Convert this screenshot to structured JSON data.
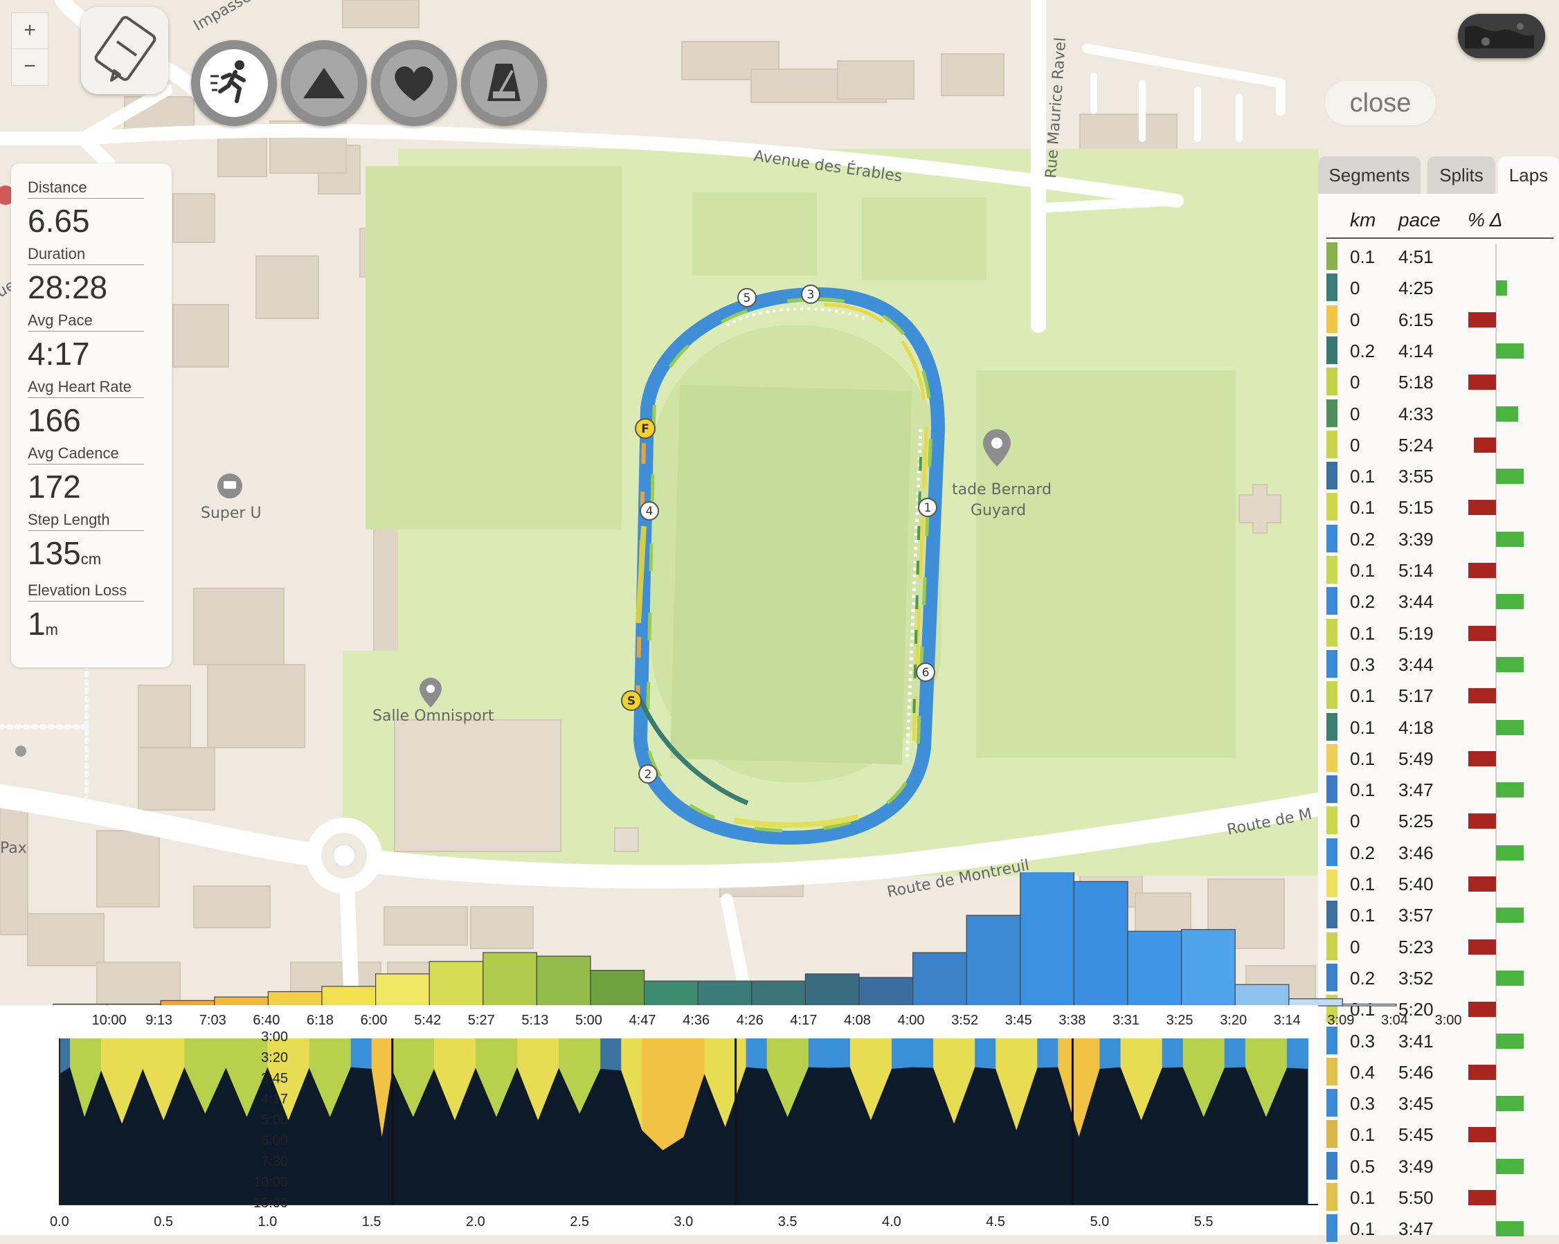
{
  "map": {
    "labels": {
      "impasse": "Impasse",
      "avenue": "Avenue des Érables",
      "rue_ravel": "Rue Maurice Ravel",
      "super_u": "Super U",
      "salle": "Salle Omnisport",
      "stade_line1": "tade Bernard",
      "stade_line2": "Guyard",
      "route1": "Route de M",
      "route2": "Route de Montreuil",
      "pax": "Pax",
      "ue": "ue"
    },
    "markers": {
      "start": "S",
      "finish": "F",
      "laps": [
        "1",
        "2",
        "3",
        "4",
        "5",
        "6"
      ]
    },
    "zoom_in": "+",
    "zoom_out": "−",
    "colors": {
      "grass": "#cfe3a4",
      "park": "#dcebb6",
      "building": "#dfd5c6",
      "road": "#ffffff",
      "track_blue": "#3f8fd8"
    }
  },
  "controls": {
    "modes": [
      {
        "icon": "runner-icon",
        "active": true
      },
      {
        "icon": "mountain-icon",
        "active": false
      },
      {
        "icon": "heart-icon",
        "active": false
      },
      {
        "icon": "metronome-icon",
        "active": false
      }
    ],
    "close_label": "close"
  },
  "stats": [
    {
      "label": "Distance",
      "value": "6.65",
      "unit": ""
    },
    {
      "label": "Duration",
      "value": "28:28",
      "unit": ""
    },
    {
      "label": "Avg Pace",
      "value": "4:17",
      "unit": ""
    },
    {
      "label": "Avg Heart Rate",
      "value": "166",
      "unit": ""
    },
    {
      "label": "Avg Cadence",
      "value": "172",
      "unit": ""
    },
    {
      "label": "Step Length",
      "value": "135",
      "unit": "cm"
    },
    {
      "label": "Elevation Loss",
      "value": "1",
      "unit": "m"
    }
  ],
  "tabs": [
    {
      "label": "Segments",
      "active": false
    },
    {
      "label": "Splits",
      "active": false
    },
    {
      "label": "Laps",
      "active": true
    }
  ],
  "laps": {
    "headers": {
      "km": "km",
      "pace": "pace",
      "delta": "% Δ"
    },
    "rows": [
      {
        "km": "0.1",
        "pace": "4:51",
        "color": "#8bb24a",
        "delta": 0
      },
      {
        "km": "0",
        "pace": "4:25",
        "color": "#3a7f78",
        "delta": 0.4
      },
      {
        "km": "0",
        "pace": "6:15",
        "color": "#f1c644",
        "delta": -1
      },
      {
        "km": "0.2",
        "pace": "4:14",
        "color": "#39786f",
        "delta": 1
      },
      {
        "km": "0",
        "pace": "5:18",
        "color": "#c4d24a",
        "delta": -1
      },
      {
        "km": "0",
        "pace": "4:33",
        "color": "#4e8f5a",
        "delta": 0.8
      },
      {
        "km": "0",
        "pace": "5:24",
        "color": "#c9d34b",
        "delta": -0.8
      },
      {
        "km": "0.1",
        "pace": "3:55",
        "color": "#3c6fa2",
        "delta": 1
      },
      {
        "km": "0.1",
        "pace": "5:15",
        "color": "#ccd84a",
        "delta": -1
      },
      {
        "km": "0.2",
        "pace": "3:39",
        "color": "#3b8bd6",
        "delta": 1
      },
      {
        "km": "0.1",
        "pace": "5:14",
        "color": "#c9d84d",
        "delta": -1
      },
      {
        "km": "0.2",
        "pace": "3:44",
        "color": "#3b8bd6",
        "delta": 1
      },
      {
        "km": "0.1",
        "pace": "5:19",
        "color": "#c7d64a",
        "delta": -1
      },
      {
        "km": "0.3",
        "pace": "3:44",
        "color": "#3b8bd6",
        "delta": 1
      },
      {
        "km": "0.1",
        "pace": "5:17",
        "color": "#c8d64b",
        "delta": -1
      },
      {
        "km": "0.1",
        "pace": "4:18",
        "color": "#3c7f70",
        "delta": 1
      },
      {
        "km": "0.1",
        "pace": "5:49",
        "color": "#eecf50",
        "delta": -1
      },
      {
        "km": "0.1",
        "pace": "3:47",
        "color": "#3d7cc0",
        "delta": 1
      },
      {
        "km": "0",
        "pace": "5:25",
        "color": "#cbd74a",
        "delta": -1
      },
      {
        "km": "0.2",
        "pace": "3:46",
        "color": "#3b8bd6",
        "delta": 1
      },
      {
        "km": "0.1",
        "pace": "5:40",
        "color": "#f0e15a",
        "delta": -1
      },
      {
        "km": "0.1",
        "pace": "3:57",
        "color": "#3c6fa2",
        "delta": 1
      },
      {
        "km": "0",
        "pace": "5:23",
        "color": "#c9d34b",
        "delta": -1
      },
      {
        "km": "0.2",
        "pace": "3:52",
        "color": "#3b82c8",
        "delta": 1
      },
      {
        "km": "0.1",
        "pace": "5:20",
        "color": "#cbd74a",
        "delta": -1
      },
      {
        "km": "0.3",
        "pace": "3:41",
        "color": "#3b8bd6",
        "delta": 1
      },
      {
        "km": "0.4",
        "pace": "5:46",
        "color": "#e2c14a",
        "delta": -1
      },
      {
        "km": "0.3",
        "pace": "3:45",
        "color": "#3b8bd6",
        "delta": 1
      },
      {
        "km": "0.1",
        "pace": "5:45",
        "color": "#d9b84a",
        "delta": -1
      },
      {
        "km": "0.5",
        "pace": "3:49",
        "color": "#3b80c8",
        "delta": 1
      },
      {
        "km": "0.1",
        "pace": "5:50",
        "color": "#e2c14a",
        "delta": -1
      },
      {
        "km": "0.1",
        "pace": "3:47",
        "color": "#3b8bd6",
        "delta": 1
      }
    ]
  },
  "chart_data": [
    {
      "type": "bar",
      "title": "",
      "categories": [
        "10:00",
        "9:13",
        "7:03",
        "6:40",
        "6:18",
        "6:00",
        "5:42",
        "5:27",
        "5:13",
        "5:00",
        "4:47",
        "4:36",
        "4:26",
        "4:17",
        "4:08",
        "4:00",
        "3:52",
        "3:45",
        "3:38",
        "3:31",
        "3:25",
        "3:20",
        "3:14",
        "3:09",
        "3:04",
        "3:00"
      ],
      "values": [
        1,
        1,
        3,
        5,
        8,
        11,
        18,
        25,
        30,
        28,
        20,
        14,
        14,
        14,
        18,
        16,
        30,
        51,
        96,
        70,
        42,
        43,
        12,
        4,
        1,
        0
      ],
      "colors": [
        "#a8c24a",
        "#a8c24a",
        "#f0a63a",
        "#f4b93c",
        "#f2cf47",
        "#f2e14e",
        "#f0e762",
        "#d7dd53",
        "#b1cc4d",
        "#93bd4a",
        "#6ea23e",
        "#3c8c70",
        "#3a7d78",
        "#3b7478",
        "#3a6c80",
        "#3b6c9e",
        "#3b82c8",
        "#3b8bd6",
        "#3b92de",
        "#3b8ee0",
        "#3d96e6",
        "#4ea3ea",
        "#8ec3f0",
        "#c0dcf4",
        "#dde9f4",
        "#dde9f4"
      ],
      "xlabel": "",
      "ylabel": ""
    },
    {
      "type": "area",
      "title": "",
      "x_ticks": [
        "0.0",
        "0.5",
        "1.0",
        "1.5",
        "2.0",
        "2.5",
        "3.0",
        "3.5",
        "4.0",
        "4.5",
        "5.0",
        "5.5"
      ],
      "y_ticks": [
        "3:00",
        "3:20",
        "3:45",
        "4:17",
        "5:00",
        "6:00",
        "7:30",
        "10:00",
        "15:00"
      ],
      "xlim": [
        0,
        6.05
      ],
      "series": [
        {
          "x": [
            0.0,
            0.05,
            0.12,
            0.2,
            0.3,
            0.4,
            0.5,
            0.6,
            0.7,
            0.8,
            0.9,
            1.0,
            1.1,
            1.2,
            1.3,
            1.4,
            1.5,
            1.55,
            1.6,
            1.7,
            1.8,
            1.9,
            2.0,
            2.1,
            2.2,
            2.3,
            2.4,
            2.5,
            2.6,
            2.7,
            2.8,
            2.9,
            3.0,
            3.1,
            3.2,
            3.3,
            3.4,
            3.5,
            3.6,
            3.7,
            3.8,
            3.9,
            4.0,
            4.1,
            4.2,
            4.3,
            4.4,
            4.5,
            4.6,
            4.7,
            4.8,
            4.9,
            5.0,
            5.1,
            5.2,
            5.3,
            5.4,
            5.5,
            5.6,
            5.7,
            5.8,
            5.9,
            6.0
          ],
          "y": [
            3.9,
            3.7,
            5.2,
            3.8,
            5.4,
            3.75,
            5.3,
            3.7,
            5.1,
            3.72,
            5.2,
            3.7,
            5.3,
            3.72,
            5.2,
            3.7,
            3.75,
            5.8,
            3.8,
            5.2,
            3.75,
            5.3,
            3.72,
            5.2,
            3.7,
            5.3,
            3.72,
            5.1,
            3.75,
            3.8,
            5.6,
            6.2,
            5.8,
            3.9,
            5.5,
            3.7,
            3.75,
            5.2,
            3.7,
            3.72,
            3.7,
            5.3,
            3.75,
            3.7,
            3.72,
            5.4,
            3.7,
            3.75,
            5.6,
            3.72,
            3.7,
            5.8,
            3.75,
            3.7,
            5.3,
            3.72,
            3.7,
            5.2,
            3.72,
            3.7,
            5.2,
            3.72,
            3.75
          ]
        }
      ]
    }
  ]
}
